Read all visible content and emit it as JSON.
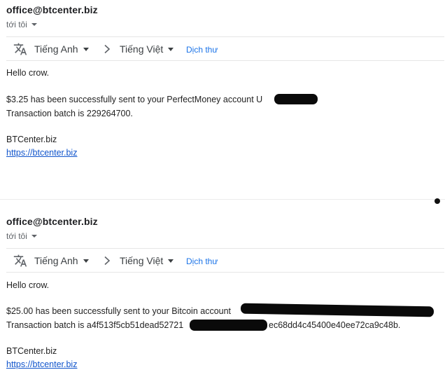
{
  "emails": [
    {
      "sender": "office@btcenter.biz",
      "to_label": "tới tôi",
      "translate": {
        "source_lang": "Tiếng Anh",
        "target_lang": "Tiếng Việt",
        "action": "Dịch thư"
      },
      "greeting": "Hello crow.",
      "line1": "$3.25 has been successfully sent to your PerfectMoney account U",
      "line2": "Transaction batch is 229264700.",
      "signature": "BTCenter.biz",
      "link": "https://btcenter.biz"
    },
    {
      "sender": "office@btcenter.biz",
      "to_label": "tới tôi",
      "translate": {
        "source_lang": "Tiếng Anh",
        "target_lang": "Tiếng Việt",
        "action": "Dịch thư"
      },
      "greeting": "Hello crow.",
      "line1": "$25.00 has been successfully sent to your Bitcoin account",
      "line2_prefix": "Transaction batch is a4f513f5cb51dead52721",
      "line2_suffix": "ec68dd4c45400e40ee72ca9c48b.",
      "signature": "BTCenter.biz",
      "link": "https://btcenter.biz"
    }
  ],
  "icons": {
    "translate": "translate-icon",
    "arrow": "chevron-right-icon",
    "dropdown": "chevron-down-icon"
  },
  "colors": {
    "link": "#1155cc",
    "translate_link": "#1a73e8",
    "muted": "#5f6368"
  }
}
